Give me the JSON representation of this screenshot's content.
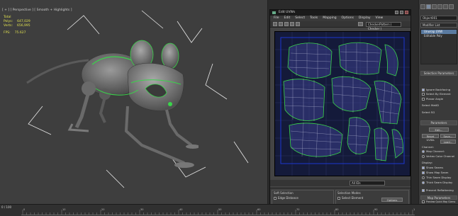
{
  "viewport": {
    "label": "[ + ] [ Perspective ] [ Smooth + Highlights ]",
    "stats": [
      {
        "name": "Total",
        "value": ""
      },
      {
        "name": "Polys:",
        "value": "647,029"
      },
      {
        "name": "Verts:",
        "value": "656,995"
      },
      {
        "name": "FPS:",
        "value": "75.627"
      }
    ]
  },
  "uv_editor": {
    "title": "Edit UVWs",
    "menu": [
      "File",
      "Edit",
      "Select",
      "Tools",
      "Mapping",
      "Options",
      "Display",
      "View"
    ],
    "texture_dropdown": "CheckerPattern ( Checker )",
    "zoom_dropdown": "All IDs",
    "panels": {
      "soft_selection": "Soft Selection",
      "edge_distance": "Edge Distance",
      "selection_modes": "Selection Modes",
      "select_element": "Select Element",
      "options": "Options"
    }
  },
  "command_panel": {
    "object_name": "Object001",
    "modifier_list": "Modifier List",
    "stack": [
      {
        "label": "Unwrap UVW",
        "selected": true
      },
      {
        "label": "Editable Poly",
        "selected": false
      }
    ],
    "rollouts": {
      "selection": "Selection Parameters",
      "parameters": "Parameters",
      "map_params": "Map Parameters"
    },
    "items": {
      "ignore_backfacing": "Ignore Backfacing",
      "select_by_element": "Select By Element",
      "planar_angle": "Planar Angle",
      "select_mat_id": "Select MatID",
      "select_by_sg": "Select SG",
      "edit": "Edit...",
      "reset_uvws": "Reset UVWs",
      "save": "Save...",
      "load": "Load...",
      "channel": "Channel:",
      "map_channel": "Map Channel:",
      "vertex_color_channel": "Vertex Color Channel",
      "display": "Display:",
      "show_seams": "Show Seams",
      "show_map_seam": "Show Map Seam",
      "thin_seam_display": "Thin Seam Display",
      "thick_seam_display": "Thick Seam Display",
      "prevent_reflattening": "Prevent Reflattening",
      "preview_quick_map": "Preview Quick Map Gizmo"
    }
  },
  "timeline": {
    "frame_counter": "0 / 100",
    "ticks": [
      "0",
      "10",
      "20",
      "30",
      "40",
      "50",
      "60",
      "70",
      "80",
      "90",
      "100"
    ]
  },
  "colors": {
    "viewport_bg": "#3e3e3e",
    "uv_canvas_bg": "#141a3a",
    "uv_wire": "#d8dcf0",
    "seam": "#39d54a",
    "stats_text": "#e0e050"
  }
}
